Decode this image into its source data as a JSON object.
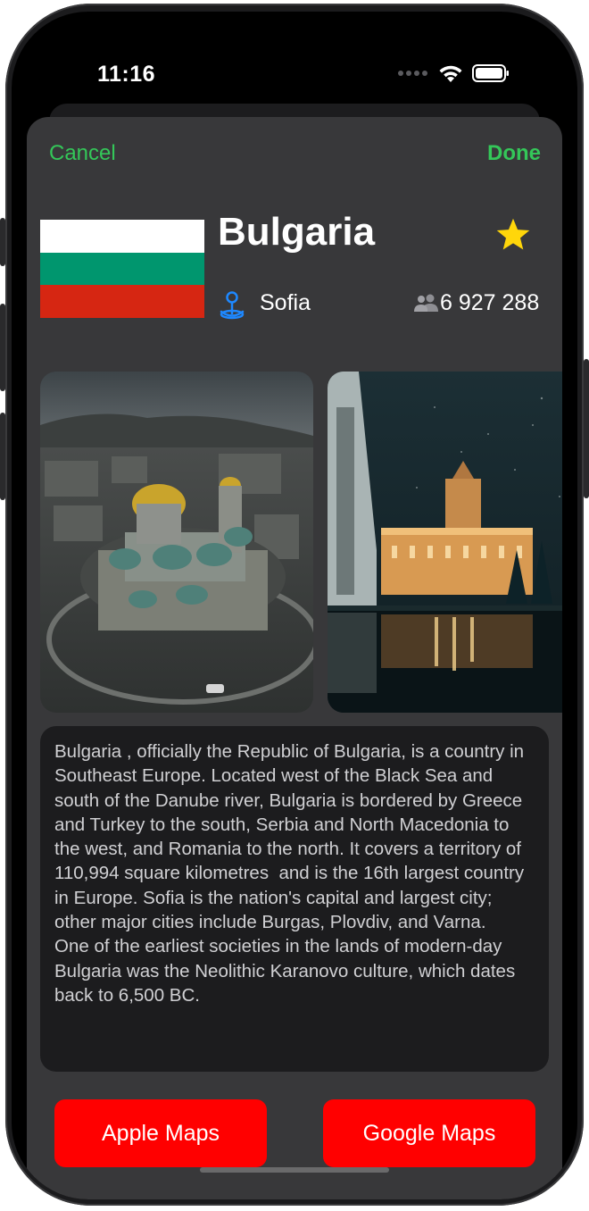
{
  "status_bar": {
    "time": "11:16"
  },
  "nav": {
    "cancel_label": "Cancel",
    "done_label": "Done"
  },
  "country": {
    "name": "Bulgaria",
    "capital": "Sofia",
    "population": "6 927 288",
    "flag_colors": [
      "#ffffff",
      "#00966e",
      "#d62612"
    ],
    "favorite": true
  },
  "photos": [
    {
      "subject": "Alexander Nevsky Cathedral aerial view"
    },
    {
      "subject": "Government building at night with reflection"
    }
  ],
  "description": "Bulgaria , officially the Republic of Bulgaria, is a country in Southeast Europe. Located west of the Black Sea and south of the Danube river, Bulgaria is bordered by Greece and Turkey to the south, Serbia and North Macedonia to the west, and Romania to the north. It covers a territory of 110,994 square kilometres  and is the 16th largest country in Europe. Sofia is the nation's capital and largest city; other major cities include Burgas, Plovdiv, and Varna.\nOne of the earliest societies in the lands of modern-day Bulgaria was the Neolithic Karanovo culture, which dates back to 6,500 BC.",
  "buttons": {
    "apple_maps": "Apple Maps",
    "google_maps": "Google Maps"
  },
  "colors": {
    "accent": "#34c759",
    "sheet": "#38383a",
    "card": "#1c1c1e",
    "map_button": "#ff0000",
    "star": "#ffd60a"
  },
  "icons": {
    "capital": "map-pin-icon",
    "population": "people-icon",
    "favorite": "star-icon"
  }
}
